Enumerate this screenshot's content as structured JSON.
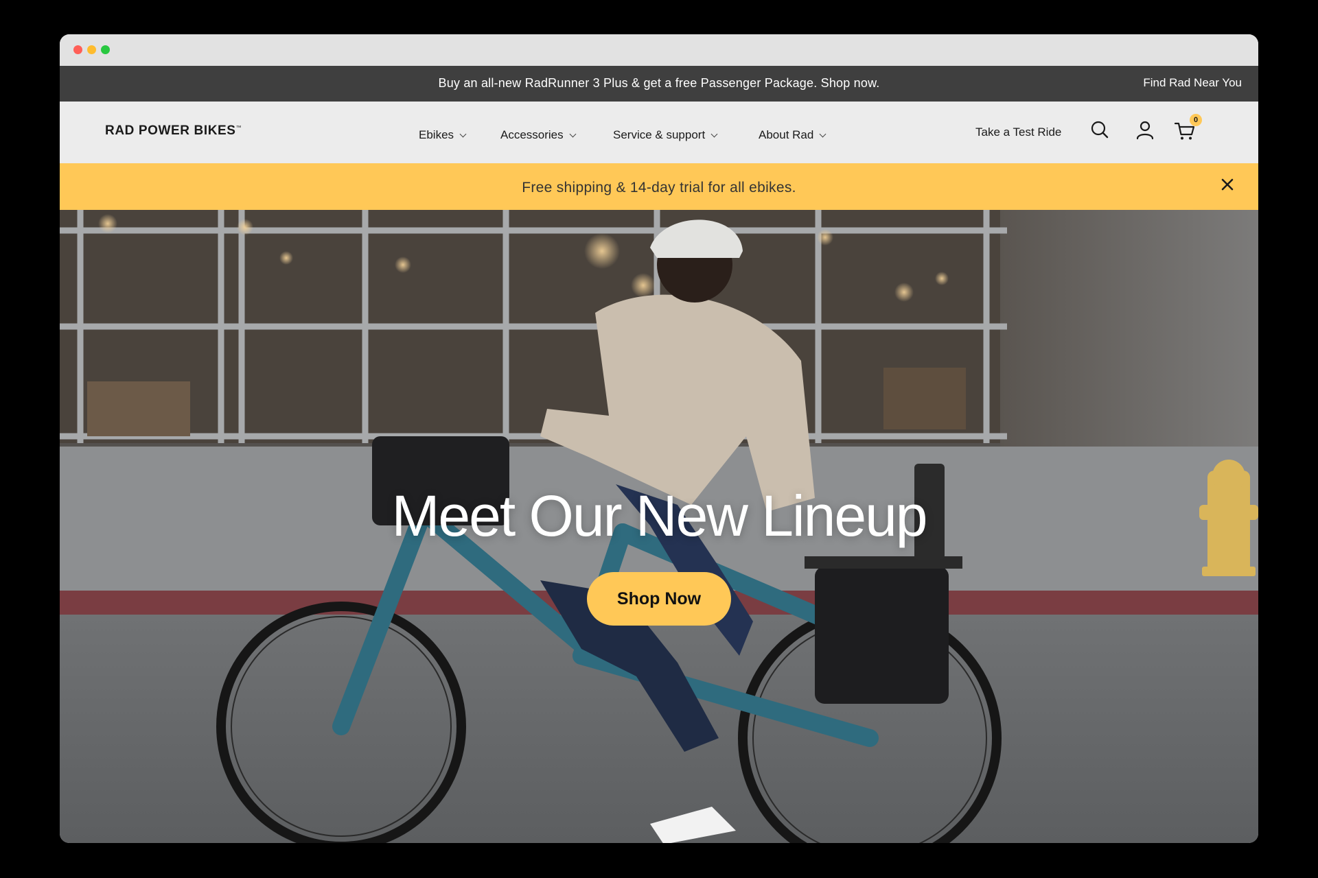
{
  "window": {
    "controls": [
      "close",
      "minimize",
      "zoom"
    ],
    "colors": {
      "close": "#ff5f57",
      "minimize": "#febc2e",
      "zoom": "#28c840"
    }
  },
  "promo": {
    "text": "Buy an all-new RadRunner 3 Plus & get a free Passenger Package. Shop now.",
    "find_link": "Find Rad Near You"
  },
  "nav": {
    "logo": "RAD POWER BIKES",
    "logo_mark": "™",
    "items": [
      {
        "label": "Ebikes"
      },
      {
        "label": "Accessories"
      },
      {
        "label": "Service & support"
      },
      {
        "label": "About Rad"
      }
    ],
    "test_ride": "Take a Test Ride",
    "icons": [
      "search-icon",
      "account-icon",
      "cart-icon"
    ],
    "cart_count": "0"
  },
  "shipping": {
    "text": "Free shipping & 14-day trial for all ebikes.",
    "close_icon": "close-icon"
  },
  "hero": {
    "title": "Meet Our New Lineup",
    "cta": "Shop Now",
    "image": "rider-on-teal-ebike-city-street"
  },
  "colors": {
    "brand_yellow": "#ffc857",
    "promo_bar": "#3f3f3f",
    "nav_bg": "#ececec",
    "bike_teal": "#2f6b7e"
  }
}
